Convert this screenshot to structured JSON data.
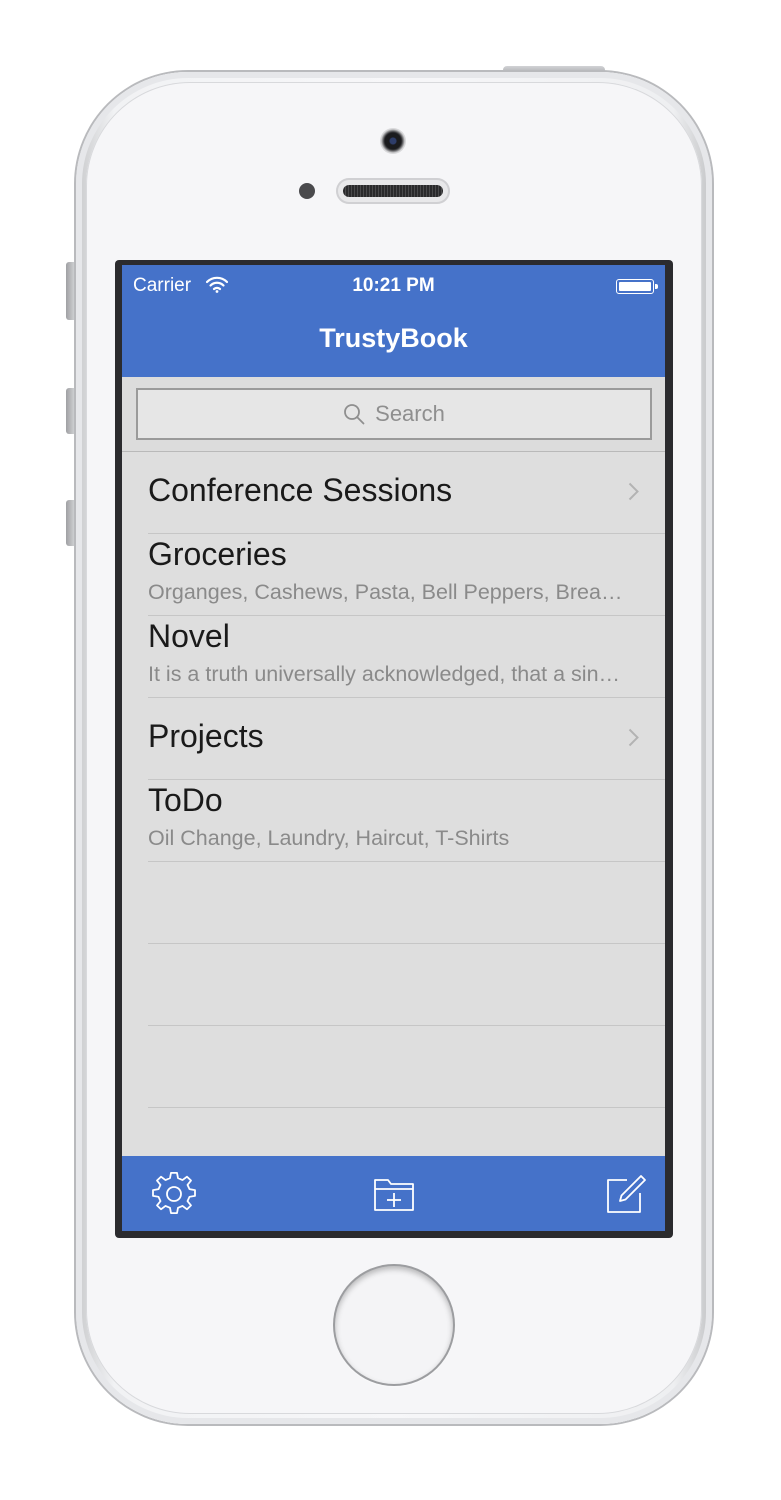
{
  "status_bar": {
    "carrier": "Carrier",
    "time": "10:21 PM",
    "wifi_icon": "wifi-icon",
    "battery_icon": "battery-icon"
  },
  "nav": {
    "title": "TrustyBook"
  },
  "search": {
    "placeholder": "Search",
    "icon": "search-icon"
  },
  "list": {
    "items": [
      {
        "title": "Conference Sessions",
        "subtitle": "",
        "disclosure": true
      },
      {
        "title": "Groceries",
        "subtitle": "Organges, Cashews, Pasta, Bell Peppers, Bread, Milk",
        "disclosure": false
      },
      {
        "title": "Novel",
        "subtitle": "It is a truth universally acknowledged, that a single man",
        "disclosure": false
      },
      {
        "title": "Projects",
        "subtitle": "",
        "disclosure": true
      },
      {
        "title": "ToDo",
        "subtitle": "Oil Change, Laundry, Haircut, T-Shirts",
        "disclosure": false
      }
    ]
  },
  "toolbar": {
    "left_icon": "gear-icon",
    "center_icon": "new-folder-icon",
    "right_icon": "compose-icon"
  },
  "colors": {
    "accent": "#4572c9",
    "list_background": "#dedede"
  }
}
